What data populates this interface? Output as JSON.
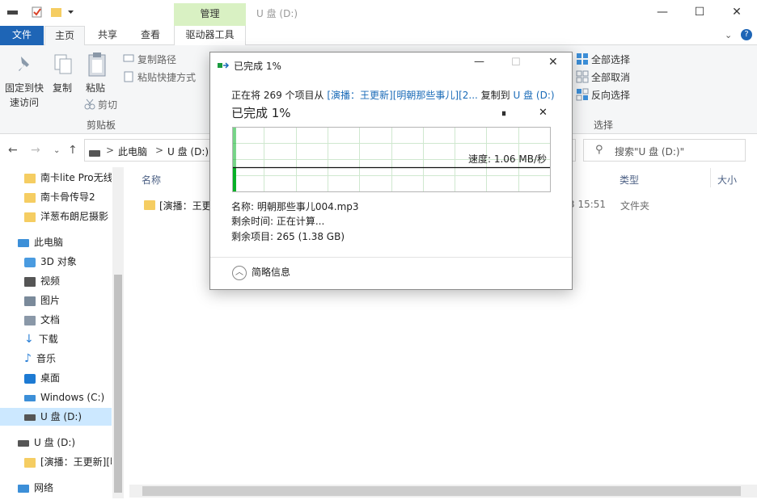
{
  "title_bar": {
    "manage_tab": "管理",
    "window_title": "U 盘 (D:)",
    "minimize": "—",
    "maximize": "☐",
    "close": "✕"
  },
  "ribbon_tabs": {
    "file": "文件",
    "home": "主页",
    "share": "共享",
    "view": "查看",
    "drive_tools": "驱动器工具"
  },
  "ribbon": {
    "pin_quick_access_line1": "固定到快",
    "pin_quick_access_line2": "速访问",
    "copy": "复制",
    "paste": "粘贴",
    "copy_path": "复制路径",
    "paste_shortcut": "粘贴快捷方式",
    "cut": "剪切",
    "clipboard_group": "剪贴板",
    "select_all": "全部选择",
    "select_none": "全部取消",
    "invert_selection": "反向选择",
    "select_group": "选择"
  },
  "address_bar": {
    "crumb_pc": "此电脑",
    "crumb_sep": ">",
    "crumb_drive": "U 盘 (D:)",
    "search_placeholder": "搜索\"U 盘 (D:)\""
  },
  "nav_pane": {
    "items": [
      {
        "label": "南卡lite Pro无线"
      },
      {
        "label": "南卡骨传导2"
      },
      {
        "label": "洋葱布朗尼摄影"
      },
      {
        "label": "此电脑"
      },
      {
        "label": "3D 对象"
      },
      {
        "label": "视频"
      },
      {
        "label": "图片"
      },
      {
        "label": "文档"
      },
      {
        "label": "下载"
      },
      {
        "label": "音乐"
      },
      {
        "label": "桌面"
      },
      {
        "label": "Windows (C:)"
      },
      {
        "label": "U 盘 (D:)"
      },
      {
        "label": "U 盘 (D:)"
      },
      {
        "label": "[演播：王更新][明"
      },
      {
        "label": "网络"
      }
    ]
  },
  "content": {
    "columns": {
      "name": "名称",
      "type": "类型",
      "size": "大小"
    },
    "rows": [
      {
        "name": "[演播：王更新][明朝那些事儿][2...",
        "date": "3 15:51",
        "type": "文件夹"
      }
    ]
  },
  "dialog": {
    "title": "已完成 1%",
    "copy_prefix": "正在将 269 个项目从 ",
    "source": "[演播：王更新][明朝那些事儿][2...",
    "copy_middle": " 复制到 ",
    "destination": "U 盘 (D:)",
    "progress_heading": "已完成 1%",
    "pause_glyph": "⏸",
    "cancel_glyph": "✕",
    "progress_percent": 1,
    "speed_label": "速度: 1.06 MB/秒",
    "name_line": "名称: 明朝那些事儿004.mp3",
    "time_line": "剩余时间: 正在计算...",
    "items_line": "剩余项目: 265 (1.38 GB)",
    "less_details": "简略信息"
  },
  "colors": {
    "file_tab": "#1e65b6",
    "manage_tab": "#d9f1c3",
    "progress_green": "#06b025",
    "link_blue": "#1a6bb8",
    "folder_yellow": "#f5cd62"
  }
}
